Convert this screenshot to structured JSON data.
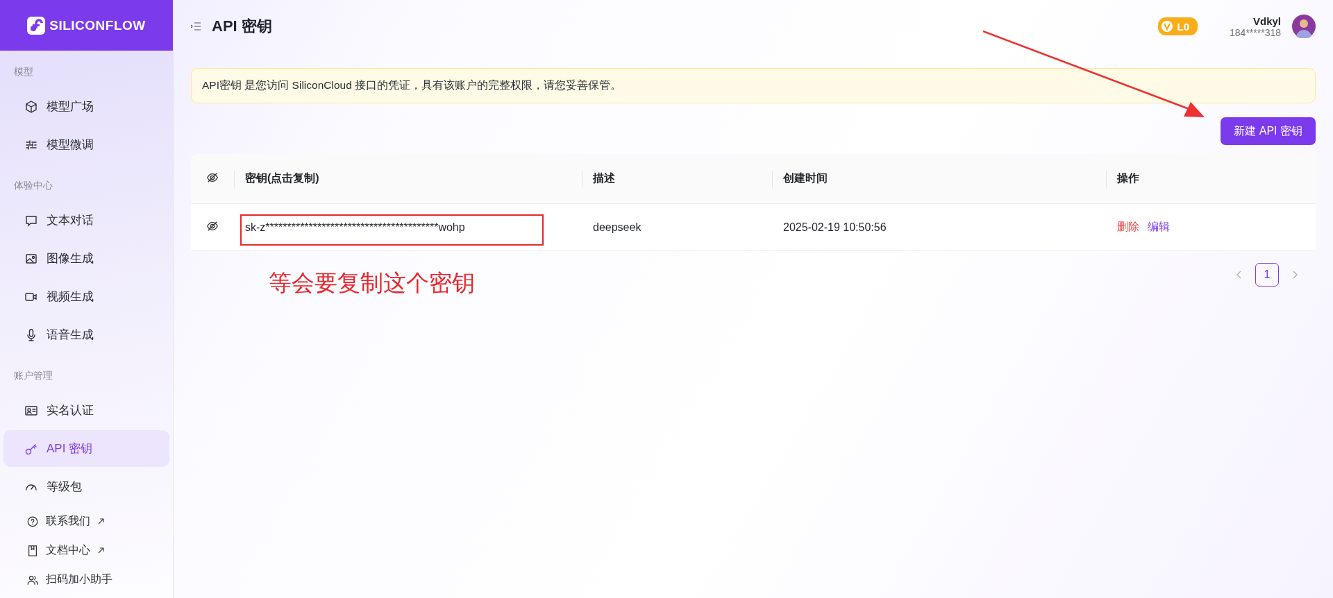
{
  "sidebar": {
    "logo": "SILICONFLOW",
    "groups": [
      {
        "label": "模型",
        "items": [
          {
            "label": "模型广场",
            "selected": false
          },
          {
            "label": "模型微调",
            "selected": false
          }
        ]
      },
      {
        "label": "体验中心",
        "items": [
          {
            "label": "文本对话",
            "selected": false
          },
          {
            "label": "图像生成",
            "selected": false
          },
          {
            "label": "视频生成",
            "selected": false
          },
          {
            "label": "语音生成",
            "selected": false
          }
        ]
      },
      {
        "label": "账户管理",
        "items": [
          {
            "label": "实名认证",
            "selected": false
          },
          {
            "label": "API 密钥",
            "selected": true
          },
          {
            "label": "等级包",
            "selected": false
          }
        ]
      }
    ],
    "footer": [
      {
        "label": "联系我们",
        "external": true
      },
      {
        "label": "文档中心",
        "external": true
      },
      {
        "label": "扫码加小助手",
        "external": false
      }
    ]
  },
  "header": {
    "title": "API 密钥",
    "level_badge": "L0",
    "user": {
      "name": "Vdkyl",
      "phone": "184*****318"
    }
  },
  "notice": "API密钥 是您访问 SiliconCloud 接口的凭证，具有该账户的完整权限，请您妥善保管。",
  "create_button": "新建 API 密钥",
  "table": {
    "columns": [
      "密钥(点击复制)",
      "描述",
      "创建时间",
      "操作"
    ],
    "rows": [
      {
        "key": "sk-z****************************************wohp",
        "description": "deepseek",
        "created": "2025-02-19 10:50:56",
        "actions": [
          {
            "label": "删除",
            "kind": "danger"
          },
          {
            "label": "编辑",
            "kind": "primary"
          }
        ]
      }
    ]
  },
  "pagination": {
    "pages": [
      {
        "label": "1",
        "selected": true
      }
    ]
  },
  "annotation": {
    "text": "等会要复制这个密钥"
  }
}
